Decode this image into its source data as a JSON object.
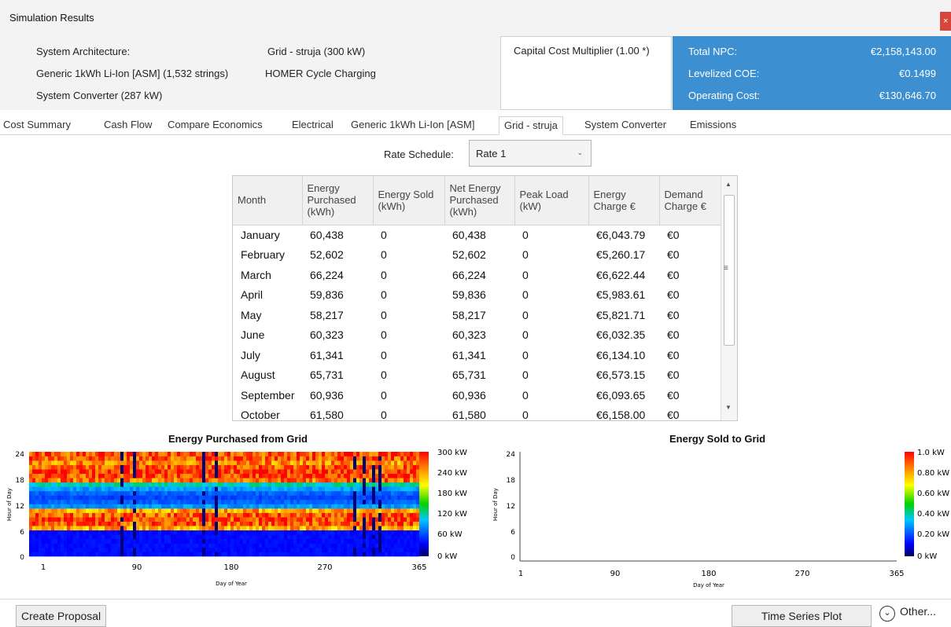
{
  "window": {
    "title": "Simulation Results",
    "close": "×"
  },
  "architecture": {
    "label": "System Architecture:",
    "grid": "Grid - struja (300 kW)",
    "battery": "Generic 1kWh Li-Ion [ASM] (1,532 strings)",
    "dispatch": "HOMER Cycle Charging",
    "converter": "System Converter (287 kW)"
  },
  "capital_cost_multiplier": "Capital Cost Multiplier (1.00 *)",
  "metrics": {
    "npc_label": "Total NPC:",
    "npc_value": "€2,158,143.00",
    "coe_label": "Levelized COE:",
    "coe_value": "€0.1499",
    "opcost_label": "Operating Cost:",
    "opcost_value": "€130,646.70",
    "panel_color": "#3c8fd0"
  },
  "tabs": [
    "Cost Summary",
    "Cash Flow",
    "Compare Economics",
    "Electrical",
    "Generic 1kWh Li-Ion [ASM]",
    "Grid - struja",
    "System Converter",
    "Emissions"
  ],
  "active_tab": "Grid - struja",
  "rate_schedule": {
    "label": "Rate Schedule:",
    "value": "Rate 1"
  },
  "table": {
    "headers": [
      "Month",
      "Energy Purchased (kWh)",
      "Energy Sold (kWh)",
      "Net Energy Purchased (kWh)",
      "Peak Load (kW)",
      "Energy Charge €",
      "Demand Charge €"
    ],
    "rows": [
      [
        "January",
        "60,438",
        "0",
        "60,438",
        "0",
        "€6,043.79",
        "€0"
      ],
      [
        "February",
        "52,602",
        "0",
        "52,602",
        "0",
        "€5,260.17",
        "€0"
      ],
      [
        "March",
        "66,224",
        "0",
        "66,224",
        "0",
        "€6,622.44",
        "€0"
      ],
      [
        "April",
        "59,836",
        "0",
        "59,836",
        "0",
        "€5,983.61",
        "€0"
      ],
      [
        "May",
        "58,217",
        "0",
        "58,217",
        "0",
        "€5,821.71",
        "€0"
      ],
      [
        "June",
        "60,323",
        "0",
        "60,323",
        "0",
        "€6,032.35",
        "€0"
      ],
      [
        "July",
        "61,341",
        "0",
        "61,341",
        "0",
        "€6,134.10",
        "€0"
      ],
      [
        "August",
        "65,731",
        "0",
        "65,731",
        "0",
        "€6,573.15",
        "€0"
      ],
      [
        "September",
        "60,936",
        "0",
        "60,936",
        "0",
        "€6,093.65",
        "€0"
      ],
      [
        "October",
        "61,580",
        "0",
        "61,580",
        "0",
        "€6,158.00",
        "€0"
      ]
    ]
  },
  "chart_data": [
    {
      "type": "heatmap",
      "title": "Energy Purchased from Grid",
      "xlabel": "Day of Year",
      "ylabel": "Hour of Day",
      "xlim": [
        1,
        365
      ],
      "ylim": [
        0,
        24
      ],
      "x_ticks": [
        "1",
        "90",
        "180",
        "270",
        "365"
      ],
      "y_ticks": [
        "0",
        "6",
        "12",
        "18",
        "24"
      ],
      "colorbar_ticks": [
        "300 kW",
        "240 kW",
        "180 kW",
        "120 kW",
        "60 kW",
        "0 kW"
      ],
      "hour_profile_kw": [
        40,
        40,
        40,
        40,
        40,
        40,
        240,
        270,
        280,
        270,
        240,
        90,
        70,
        60,
        70,
        90,
        120,
        260,
        280,
        280,
        270,
        250,
        270,
        280
      ]
    },
    {
      "type": "heatmap",
      "title": "Energy Sold to Grid",
      "xlabel": "Day of Year",
      "ylabel": "Hour of Day",
      "xlim": [
        1,
        365
      ],
      "ylim": [
        0,
        24
      ],
      "x_ticks": [
        "1",
        "90",
        "180",
        "270",
        "365"
      ],
      "y_ticks": [
        "0",
        "6",
        "12",
        "18",
        "24"
      ],
      "colorbar_ticks": [
        "1.0 kW",
        "0.80 kW",
        "0.60 kW",
        "0.40 kW",
        "0.20 kW",
        "0 kW"
      ],
      "hour_profile_kw": []
    }
  ],
  "buttons": {
    "create_proposal": "Create Proposal",
    "time_series_plot": "Time Series Plot",
    "other": "Other...",
    "other_icon": "chevron-down-circle-icon"
  }
}
